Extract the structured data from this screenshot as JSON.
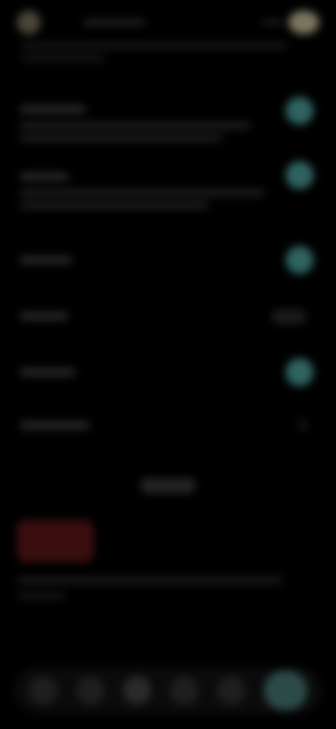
{
  "header": {
    "title": "",
    "subtitle": ""
  },
  "settings": [
    {
      "label": "",
      "description": "",
      "state": "on"
    },
    {
      "label": "",
      "description": "",
      "state": "on"
    },
    {
      "label": "",
      "description": "",
      "state": "on"
    },
    {
      "label": "",
      "description": "",
      "state": "off"
    },
    {
      "label": "",
      "description": "",
      "state": "on"
    },
    {
      "label": "",
      "description": "",
      "state": "chevron"
    }
  ],
  "center_pill": {
    "label": ""
  },
  "danger_button": {
    "label": ""
  },
  "footnote": {
    "line1": "",
    "line2": ""
  },
  "bottom_nav": {
    "items": [
      {
        "label": "",
        "active": false
      },
      {
        "label": "",
        "active": false
      },
      {
        "label": "",
        "active": false
      },
      {
        "label": "",
        "active": false
      },
      {
        "label": "",
        "active": false
      },
      {
        "label": "",
        "active": true
      }
    ]
  },
  "colors": {
    "background": "#000000",
    "toggle_on": "#2f6360",
    "active_nav": "#2c4b48",
    "danger": "#3a0e0e",
    "avatar": "#4a4538",
    "profile": "#7a7660"
  },
  "icons": [
    "avatar-icon",
    "profile-icon",
    "chevron-right-icon",
    "nav-icon"
  ]
}
